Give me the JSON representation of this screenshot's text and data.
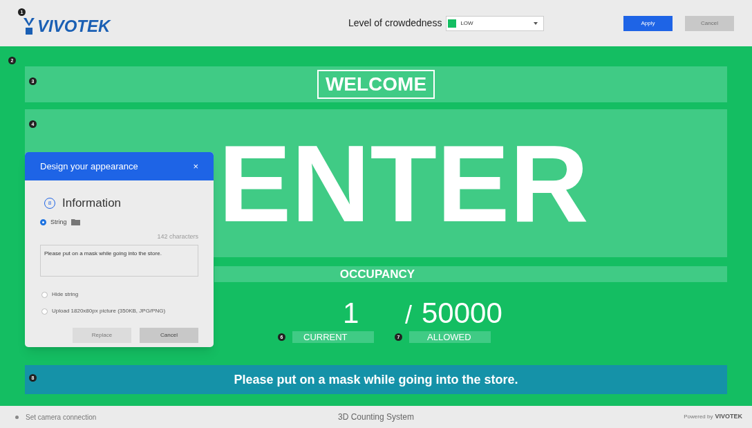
{
  "header": {
    "badge": "1",
    "logo": "VIVOTEK",
    "crowdedness": {
      "label": "Level of crowdedness",
      "value": "LOW",
      "color": "#14be62"
    },
    "buttons": [
      {
        "label": "Apply",
        "disabled": false
      },
      {
        "label": "Cancel",
        "disabled": true
      }
    ]
  },
  "display": {
    "badge": "2",
    "welcome": {
      "badge": "3",
      "text": "WELCOME"
    },
    "enter": {
      "badge": "4",
      "text": "ENTER"
    },
    "occupancy": {
      "title": "OCCUPANCY",
      "current": "1",
      "separator": "/",
      "allowed": "50000",
      "current_badge": "6",
      "current_label": "CURRENT",
      "allowed_badge": "7",
      "allowed_label": "ALLOWED"
    },
    "message": {
      "badge": "8",
      "text": "Please put on a mask while going into the store."
    }
  },
  "dialog": {
    "title": "Design your appearance",
    "close": "×",
    "section_badge": "8",
    "section_title": "Information",
    "options": [
      {
        "kind": "string",
        "label": "String",
        "selected": true,
        "counter": "142 characters",
        "value": "Please put on a mask while going into the store."
      },
      {
        "kind": "plain",
        "label": "Hide string",
        "selected": false
      },
      {
        "kind": "plain",
        "label": "Upload 1820x80px picture (350KB, JPG/PNG)",
        "selected": false
      }
    ],
    "buttons": [
      {
        "label": "Replace",
        "disabled": true
      },
      {
        "label": "Cancel",
        "disabled": false
      }
    ]
  },
  "footer": {
    "status": "Set camera connection",
    "title": "3D Counting System",
    "powered": "Powered by",
    "brand": "VIVOTEK"
  }
}
